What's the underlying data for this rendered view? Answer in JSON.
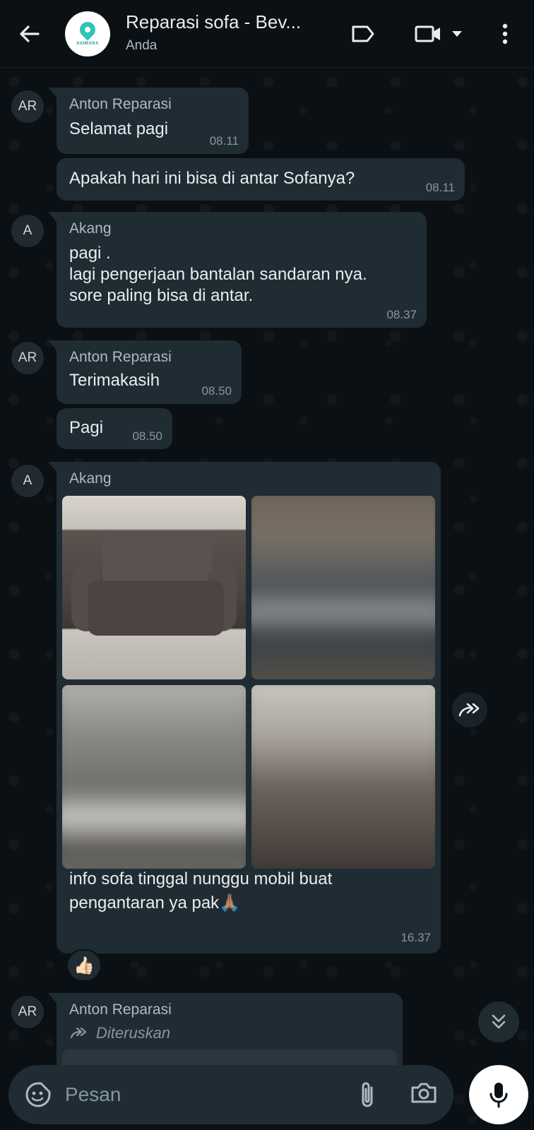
{
  "header": {
    "title": "Reparasi sofa - Bev...",
    "subtitle": "Anda",
    "logo_text": "XIOMARA"
  },
  "messages": [
    {
      "avatar": "AR",
      "sender": "Anton Reparasi",
      "lines": [
        "Selamat pagi"
      ],
      "time": "08.11"
    },
    {
      "lines": [
        "Apakah hari ini bisa di antar Sofanya?"
      ],
      "time": "08.11"
    },
    {
      "avatar": "A",
      "sender": "Akang",
      "lines": [
        "pagi .",
        "lagi pengerjaan bantalan sandaran nya.",
        "sore paling bisa di antar."
      ],
      "time": "08.37"
    },
    {
      "avatar": "AR",
      "sender": "Anton Reparasi",
      "lines": [
        "Terimakasih"
      ],
      "time": "08.50"
    },
    {
      "lines": [
        "Pagi"
      ],
      "time": "08.50"
    },
    {
      "avatar": "A",
      "sender": "Akang",
      "lines": [
        "info sofa tinggal nunggu mobil buat",
        "pengantaran ya pak🙏🏽"
      ],
      "time": "16.37",
      "reaction": "👍🏻"
    },
    {
      "avatar": "AR",
      "sender": "Anton Reparasi",
      "forwarded_label": "Diteruskan"
    }
  ],
  "input": {
    "placeholder": "Pesan"
  },
  "colors": {
    "background": "#0b1014",
    "bubble_incoming": "#202c33",
    "text_primary": "#e9edef",
    "text_secondary": "#8696a0"
  },
  "icons": [
    "back-arrow-icon",
    "label-icon",
    "video-call-icon",
    "dropdown-icon",
    "more-options-icon",
    "forward-icon",
    "scroll-down-icon",
    "sticker-icon",
    "attach-icon",
    "camera-icon",
    "mic-icon"
  ]
}
